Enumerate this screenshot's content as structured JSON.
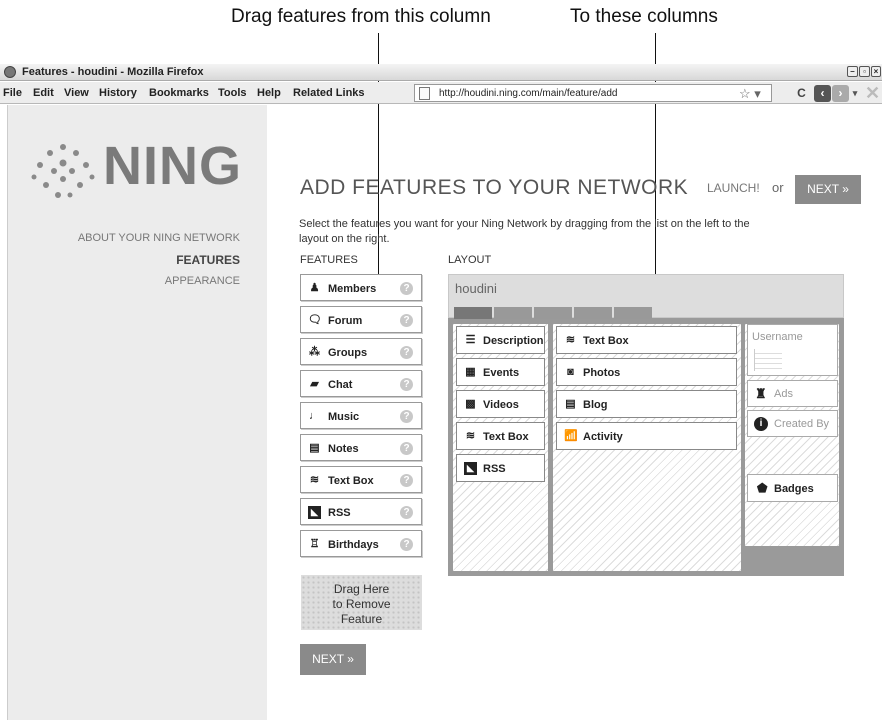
{
  "callouts": {
    "left": "Drag features from this column",
    "right": "To these columns"
  },
  "window": {
    "title": "Features - houdini - Mozilla Firefox"
  },
  "menubar": {
    "items": [
      "File",
      "Edit",
      "View",
      "History",
      "Bookmarks",
      "Tools",
      "Help",
      "Related Links"
    ],
    "url": "http://houdini.ning.com/main/feature/add"
  },
  "sidebar": {
    "logo": "NING",
    "links": [
      "ABOUT YOUR NING NETWORK",
      "FEATURES",
      "APPEARANCE"
    ],
    "active": "FEATURES"
  },
  "main": {
    "title": "ADD FEATURES TO YOUR NETWORK",
    "launch": "LAUNCH!",
    "or": "or",
    "next": "NEXT »",
    "description": "Select the features you want for your Ning Network by dragging from the list on the left to the layout on the right.",
    "features_heading": "FEATURES",
    "layout_heading": "LAYOUT",
    "features": [
      {
        "label": "Members",
        "icon": "members-icon"
      },
      {
        "label": "Forum",
        "icon": "forum-icon"
      },
      {
        "label": "Groups",
        "icon": "groups-icon"
      },
      {
        "label": "Chat",
        "icon": "chat-icon"
      },
      {
        "label": "Music",
        "icon": "music-icon"
      },
      {
        "label": "Notes",
        "icon": "notes-icon"
      },
      {
        "label": "Text Box",
        "icon": "text-box-icon"
      },
      {
        "label": "RSS",
        "icon": "rss-icon"
      },
      {
        "label": "Birthdays",
        "icon": "birthdays-icon"
      }
    ],
    "help_glyph": "?",
    "drop_zone": [
      "Drag Here",
      "to Remove",
      "Feature"
    ],
    "bottom_next": "NEXT »"
  },
  "layout": {
    "network_name": "houdini",
    "col1": [
      {
        "label": "Description",
        "icon": "description-icon"
      },
      {
        "label": "Events",
        "icon": "events-icon"
      },
      {
        "label": "Videos",
        "icon": "videos-icon"
      },
      {
        "label": "Text Box",
        "icon": "text-box-icon"
      },
      {
        "label": "RSS",
        "icon": "rss-icon"
      }
    ],
    "col2": [
      {
        "label": "Text Box",
        "icon": "text-box-icon"
      },
      {
        "label": "Photos",
        "icon": "photos-icon"
      },
      {
        "label": "Blog",
        "icon": "blog-icon"
      },
      {
        "label": "Activity",
        "icon": "activity-icon"
      }
    ],
    "col3": {
      "username": "Username",
      "ads": "Ads",
      "created_by": "Created By",
      "badges": "Badges"
    }
  }
}
